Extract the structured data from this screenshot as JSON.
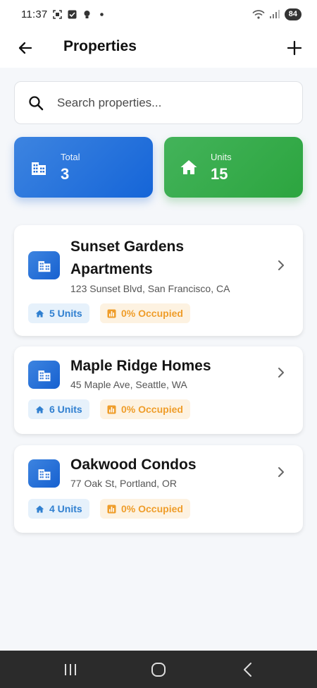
{
  "status_bar": {
    "time": "11:37",
    "battery": "84"
  },
  "app_bar": {
    "title": "Properties"
  },
  "search": {
    "placeholder": "Search properties..."
  },
  "stats": [
    {
      "label": "Total",
      "value": "3"
    },
    {
      "label": "Units",
      "value": "15"
    }
  ],
  "properties": [
    {
      "name": "Sunset Gardens Apartments",
      "address": "123 Sunset Blvd, San Francisco, CA",
      "units": "5 Units",
      "occupied": "0% Occupied"
    },
    {
      "name": "Maple Ridge Homes",
      "address": "45 Maple Ave, Seattle, WA",
      "units": "6 Units",
      "occupied": "0% Occupied"
    },
    {
      "name": "Oakwood Condos",
      "address": "77 Oak St, Portland, OR",
      "units": "4 Units",
      "occupied": "0% Occupied"
    }
  ],
  "colors": {
    "primary_blue": "#1565d8",
    "success_green": "#2ca53f",
    "units_badge_text": "#2f7fd0",
    "occupied_badge_text": "#ef9d2a"
  },
  "icons": {
    "status_bar": [
      "screenshot-icon",
      "checkbox-icon",
      "lightbulb-icon",
      "dot-icon",
      "wifi-icon",
      "signal-icon"
    ],
    "stat_total": "building-icon",
    "stat_units": "home-icon",
    "property": "building-icon",
    "units_badge": "home-icon",
    "occupied_badge": "bar-chart-icon"
  }
}
